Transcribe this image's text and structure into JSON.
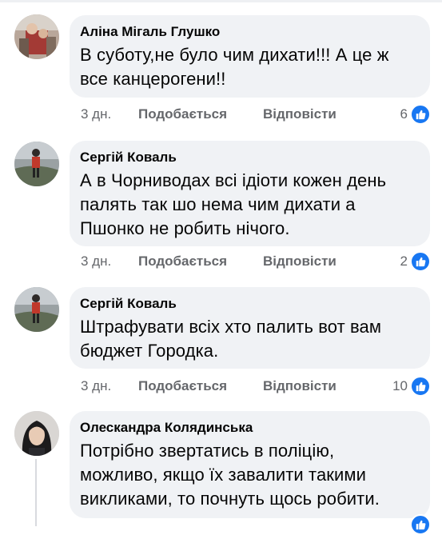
{
  "comments": [
    {
      "author": "Аліна Мігаль Глушко",
      "lines": [
        "В суботу,не було чим дихати!!! А це ж",
        "все канцерогени!!"
      ],
      "time": "3 дн.",
      "like": "Подобається",
      "reply": "Відповісти",
      "reactions": "6"
    },
    {
      "author": "Сергій Коваль",
      "lines": [
        "А в Чорниводах всі ідіоти кожен день",
        "палять так шо нема чим дихати а",
        "Пшонко не робить нічого."
      ],
      "time": "3 дн.",
      "like": "Подобається",
      "reply": "Відповісти",
      "reactions": "2"
    },
    {
      "author": "Сергій Коваль",
      "lines": [
        "Штрафувати всіх хто палить вот вам",
        "бюджет Городка."
      ],
      "time": "3 дн.",
      "like": "Подобається",
      "reply": "Відповісти",
      "reactions": "10"
    },
    {
      "author": "Олескандра Колядинська",
      "lines": [
        "Потрібно звертатись в поліцію,",
        "можливо, якщо їх завалити такими",
        "викликами, то почнуть щось робити."
      ],
      "time": "",
      "like": "",
      "reply": "",
      "reactions": ""
    }
  ],
  "icons": {
    "reaction": "like-thumb-icon",
    "avatar": "user-avatar"
  },
  "colors": {
    "like_blue": "#1877f2",
    "bubble_bg": "#f0f2f5",
    "meta_gray": "#65676b"
  }
}
